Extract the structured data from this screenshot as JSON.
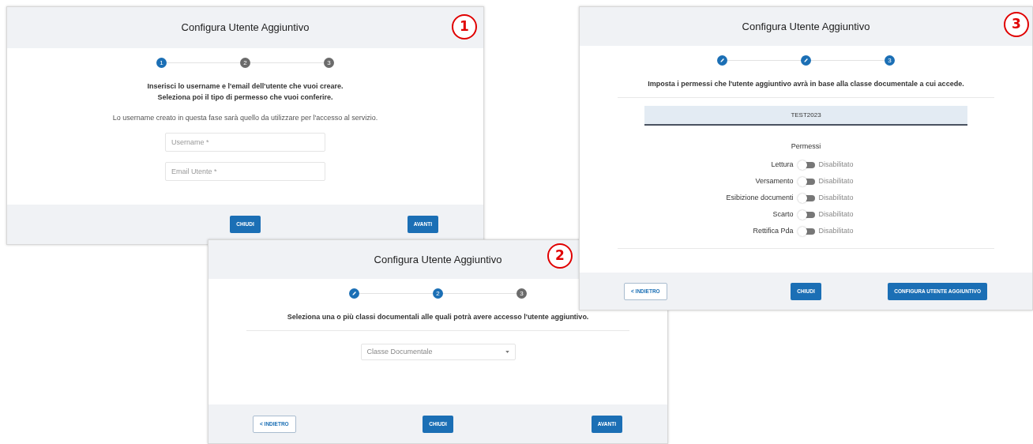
{
  "windows": [
    {
      "badge": "1",
      "title": "Configura Utente Aggiuntivo",
      "steps": [
        {
          "kind": "active",
          "label": "1"
        },
        {
          "kind": "pending",
          "label": "2"
        },
        {
          "kind": "pending",
          "label": "3"
        }
      ],
      "content": [
        {
          "kind": "instruction",
          "text": "Inserisci lo username e l'email dell'utente che vuoi creare."
        },
        {
          "kind": "instruction",
          "text": "Seleziona poi il tipo di permesso che vuoi conferire."
        },
        {
          "kind": "note",
          "text": "Lo username creato in questa fase sarà quello da utilizzare per l'accesso al servizio."
        },
        {
          "kind": "field",
          "placeholder": "Username *"
        },
        {
          "kind": "field",
          "placeholder": "Email Utente *"
        }
      ],
      "buttons": [
        {
          "label": "CHIUDI",
          "kind": "close"
        },
        {
          "label": "AVANTI",
          "kind": "next"
        }
      ]
    },
    {
      "badge": "2",
      "title": "Configura Utente Aggiuntivo",
      "steps": [
        {
          "kind": "done"
        },
        {
          "kind": "active",
          "label": "2"
        },
        {
          "kind": "pending",
          "label": "3"
        }
      ],
      "content": [
        {
          "kind": "instruction",
          "text": "Seleziona una o più classi documentali alle quali potrà avere accesso l'utente aggiuntivo."
        },
        {
          "kind": "rule"
        },
        {
          "kind": "select",
          "placeholder": "Classe Documentale"
        }
      ],
      "buttons": [
        {
          "label": "< INDIETRO",
          "kind": "back"
        },
        {
          "label": "CHIUDI",
          "kind": "close"
        },
        {
          "label": "AVANTI",
          "kind": "next"
        }
      ]
    },
    {
      "badge": "3",
      "title": "Configura Utente Aggiuntivo",
      "steps": [
        {
          "kind": "done"
        },
        {
          "kind": "done"
        },
        {
          "kind": "active",
          "label": "3"
        }
      ],
      "content": [
        {
          "kind": "instruction",
          "text": "Imposta i permessi che l'utente aggiuntivo avrà in base alla classe documentale a cui accede."
        },
        {
          "kind": "rule"
        },
        {
          "kind": "class_header",
          "text": "TEST2023"
        },
        {
          "kind": "heading",
          "text": "Permessi"
        },
        {
          "kind": "toggle",
          "label": "Lettura",
          "on": false,
          "status": "Disabilitato"
        },
        {
          "kind": "toggle",
          "label": "Versamento",
          "on": false,
          "status": "Disabilitato"
        },
        {
          "kind": "toggle",
          "label": "Esibizione documenti",
          "on": false,
          "status": "Disabilitato"
        },
        {
          "kind": "toggle",
          "label": "Scarto",
          "on": false,
          "status": "Disabilitato"
        },
        {
          "kind": "toggle",
          "label": "Rettifica Pda",
          "on": false,
          "status": "Disabilitato"
        },
        {
          "kind": "rule"
        }
      ],
      "buttons": [
        {
          "label": "< INDIETRO",
          "kind": "back"
        },
        {
          "label": "CHIUDI",
          "kind": "close"
        },
        {
          "label": "CONFIGURA UTENTE AGGIUNTIVO",
          "kind": "next"
        }
      ]
    }
  ]
}
